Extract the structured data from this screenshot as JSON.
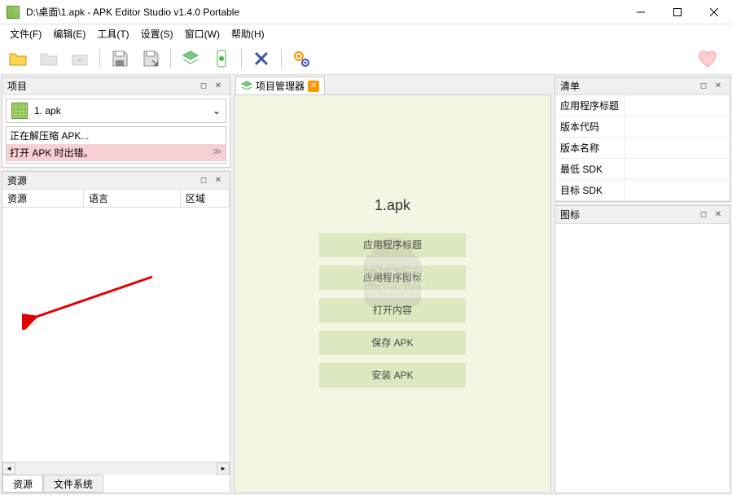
{
  "window": {
    "title": "D:\\桌面\\1.apk - APK Editor Studio v1.4.0 Portable"
  },
  "menu": {
    "file": "文件(F)",
    "edit": "编辑(E)",
    "tools": "工具(T)",
    "settings": "设置(S)",
    "window": "窗口(W)",
    "help": "帮助(H)"
  },
  "panels": {
    "project": "项目",
    "resource": "资源",
    "manifest": "清单",
    "icon": "图标",
    "project_manager": "项目管理器"
  },
  "project": {
    "current": "1. apk",
    "log_extracting": "正在解压缩 APK...",
    "log_error": "打开 APK 时出错。"
  },
  "resource": {
    "col_resource": "资源",
    "col_language": "语言",
    "col_region": "区域",
    "tab_resource": "资源",
    "tab_filesystem": "文件系统"
  },
  "manifest": {
    "app_title": "应用程序标题",
    "version_code": "版本代码",
    "version_name": "版本名称",
    "min_sdk": "最低 SDK",
    "target_sdk": "目标 SDK"
  },
  "center": {
    "apk_name": "1.apk",
    "btn_app_title": "应用程序标题",
    "btn_app_icon": "应用程序图标",
    "btn_open_content": "打开内容",
    "btn_save_apk": "保存 APK",
    "btn_install_apk": "安装 APK"
  },
  "watermark": {
    "line1": "安下载",
    "line2": "anxz.com"
  }
}
